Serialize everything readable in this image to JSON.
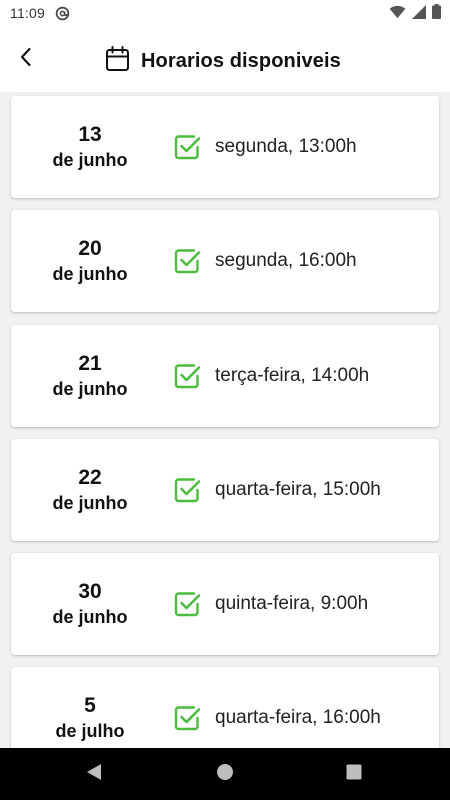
{
  "status_bar": {
    "time": "11:09",
    "left_icon": "at-sign-notification-icon",
    "right_icons": [
      "wifi-icon",
      "cellular-signal-icon",
      "battery-icon"
    ]
  },
  "header": {
    "back_icon": "chevron-left-icon",
    "title_icon": "calendar-icon",
    "title": "Horarios disponiveis"
  },
  "colors": {
    "check": "#4cbb3f",
    "card_background": "#ffffff",
    "page_background": "#f1f1f4"
  },
  "slots": [
    {
      "day": "13",
      "month": "de junho",
      "label": "segunda, 13:00h"
    },
    {
      "day": "20",
      "month": "de junho",
      "label": "segunda, 16:00h"
    },
    {
      "day": "21",
      "month": "de junho",
      "label": "terça-feira, 14:00h"
    },
    {
      "day": "22",
      "month": "de junho",
      "label": "quarta-feira, 15:00h"
    },
    {
      "day": "30",
      "month": "de junho",
      "label": "quinta-feira, 9:00h"
    },
    {
      "day": "5",
      "month": "de julho",
      "label": "quarta-feira, 16:00h"
    }
  ],
  "nav_bar": {
    "icons": [
      "back-triangle-icon",
      "home-circle-icon",
      "recents-square-icon"
    ]
  }
}
